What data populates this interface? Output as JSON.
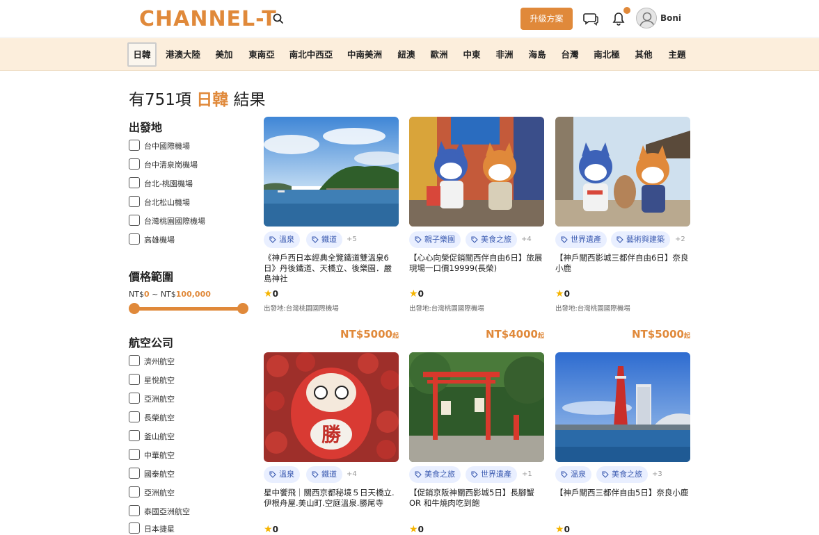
{
  "header": {
    "logo": "CHANNEL-T",
    "upgrade_label": "升級方案",
    "username": "Boni",
    "accent_color": "#E0893A"
  },
  "nav": {
    "items": [
      "日韓",
      "港澳大陸",
      "美加",
      "東南亞",
      "南北中西亞",
      "中南美洲",
      "紐澳",
      "歐洲",
      "中東",
      "非洲",
      "海島",
      "台灣",
      "南北極",
      "其他",
      "主題"
    ],
    "active": "日韓"
  },
  "results": {
    "prefix": "有751項",
    "region": "日韓",
    "suffix": "結果"
  },
  "filters": {
    "departure_heading": "出發地",
    "departures": [
      "台中國際機場",
      "台中清泉崗機場",
      "台北-桃園機場",
      "台北松山機場",
      "台灣桃園國際機場",
      "高雄機場"
    ],
    "price_heading": "價格範圍",
    "price_min_prefix": "NT$",
    "price_min": "0",
    "price_sep": "~",
    "price_max_prefix": "NT$",
    "price_max": "100,000",
    "airline_heading": "航空公司",
    "airlines": [
      "濟州航空",
      "星悅航空",
      "亞洲航空",
      "長榮航空",
      "釜山航空",
      "中華航空",
      "國泰航空",
      "亞洲航空",
      "泰國亞洲航空",
      "日本捷星"
    ]
  },
  "cards": [
    {
      "tags": [
        "溫泉",
        "鐵道"
      ],
      "more": "+5",
      "title": "《神戶西日本經典全覽鐵道雙溫泉6日》丹後鐵道、天橋立、後樂園．嚴島神社",
      "rating": "0",
      "depart": "出發地:台灣桃園國際機場",
      "price": "NT$5000",
      "price_suffix": "起"
    },
    {
      "tags": [
        "親子樂園",
        "美食之旅"
      ],
      "more": "+4",
      "title": "【心心向榮促銷關西伴自由6日】旅展現場一口價19999(長榮)",
      "rating": "0",
      "depart": "出發地:台灣桃園國際機場",
      "price": "NT$4000",
      "price_suffix": "起"
    },
    {
      "tags": [
        "世界遺產",
        "藝術與建築"
      ],
      "more": "+2",
      "title": "【神戶關西影城三都伴自由6日】奈良小鹿",
      "rating": "0",
      "depart": "出發地:台灣桃園國際機場",
      "price": "NT$5000",
      "price_suffix": "起"
    },
    {
      "tags": [
        "溫泉",
        "鐵道"
      ],
      "more": "+4",
      "title": "星中饗飛｜關西京都秘境５日天橋立.伊根舟屋.美山町.空庭溫泉.勝尾寺",
      "rating": "0"
    },
    {
      "tags": [
        "美食之旅",
        "世界遺產"
      ],
      "more": "+1",
      "title": "【促銷京阪神關西影城5日】長腳蟹OR 和牛燒肉吃到飽",
      "rating": "0"
    },
    {
      "tags": [
        "溫泉",
        "美食之旅"
      ],
      "more": "+3",
      "title": "【神戶關西三都伴自由5日】奈良小鹿",
      "rating": "0"
    }
  ]
}
